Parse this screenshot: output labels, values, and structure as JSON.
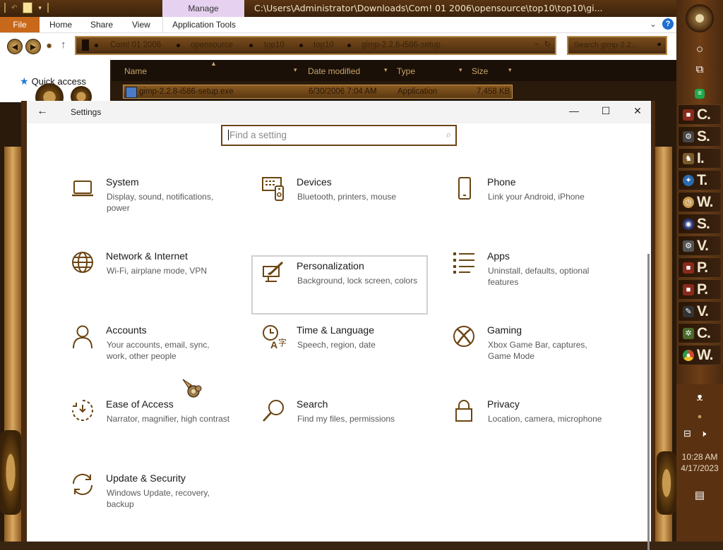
{
  "explorer": {
    "manage_tab": "Manage",
    "path": "C:\\Users\\Administrator\\Downloads\\Com! 01 2006\\opensource\\top10\\top10\\gi...",
    "ribbon": {
      "file": "File",
      "home": "Home",
      "share": "Share",
      "view": "View",
      "app_tools": "Application Tools"
    },
    "breadcrumbs": [
      "Com! 01 2006",
      "opensource",
      "top10",
      "top10",
      "gimp-2.2.8-i586-setup"
    ],
    "search_placeholder": "Search gimp-2.2...",
    "quick_access": "Quick access",
    "columns": {
      "name": "Name",
      "date": "Date modified",
      "type": "Type",
      "size": "Size"
    },
    "file": {
      "name": "gimp-2.2.8-i586-setup.exe",
      "date": "6/30/2006 7:04 AM",
      "type": "Application",
      "size": "7,458 KB"
    }
  },
  "taskbar": {
    "items": [
      {
        "letter": "C.",
        "icon": "explorer-icon",
        "color": "#8a2a1a"
      },
      {
        "letter": "S.",
        "icon": "gear-icon",
        "color": "#444444"
      },
      {
        "letter": "I.",
        "icon": "figure-icon",
        "color": "#7a5a2a"
      },
      {
        "letter": "T.",
        "icon": "globe-icon",
        "color": "#2a6ab0"
      },
      {
        "letter": "W.",
        "icon": "clock-icon",
        "color": "#c89a50"
      },
      {
        "letter": "S.",
        "icon": "steam-icon",
        "color": "#2a3a7a"
      },
      {
        "letter": "V.",
        "icon": "gear-icon",
        "color": "#555555"
      },
      {
        "letter": "P.",
        "icon": "box-icon",
        "color": "#8a2a1a"
      },
      {
        "letter": "P.",
        "icon": "box-icon",
        "color": "#8a2a1a"
      },
      {
        "letter": "V.",
        "icon": "vector-icon",
        "color": "#333333"
      },
      {
        "letter": "C.",
        "icon": "cog-icon",
        "color": "#4a6a2a"
      },
      {
        "letter": "W.",
        "icon": "chrome-icon",
        "color": "#d04a2a"
      }
    ],
    "time": "10:28 AM",
    "date": "4/17/2023"
  },
  "settings": {
    "window_title": "Settings",
    "search_placeholder": "Find a setting",
    "accent_color": "#6b4512",
    "categories": [
      {
        "name": "System",
        "desc": "Display, sound, notifications, power",
        "icon": "laptop-icon"
      },
      {
        "name": "Devices",
        "desc": "Bluetooth, printers, mouse",
        "icon": "devices-icon"
      },
      {
        "name": "Phone",
        "desc": "Link your Android, iPhone",
        "icon": "phone-icon"
      },
      {
        "name": "Network & Internet",
        "desc": "Wi-Fi, airplane mode, VPN",
        "icon": "globe-icon"
      },
      {
        "name": "Personalization",
        "desc": "Background, lock screen, colors",
        "icon": "paintbrush-icon"
      },
      {
        "name": "Apps",
        "desc": "Uninstall, defaults, optional features",
        "icon": "apps-list-icon"
      },
      {
        "name": "Accounts",
        "desc": "Your accounts, email, sync, work, other people",
        "icon": "person-icon"
      },
      {
        "name": "Time & Language",
        "desc": "Speech, region, date",
        "icon": "time-language-icon"
      },
      {
        "name": "Gaming",
        "desc": "Xbox Game Bar, captures, Game Mode",
        "icon": "xbox-icon"
      },
      {
        "name": "Ease of Access",
        "desc": "Narrator, magnifier, high contrast",
        "icon": "ease-of-access-icon"
      },
      {
        "name": "Search",
        "desc": "Find my files, permissions",
        "icon": "magnifier-icon"
      },
      {
        "name": "Privacy",
        "desc": "Location, camera, microphone",
        "icon": "lock-icon"
      },
      {
        "name": "Update & Security",
        "desc": "Windows Update, recovery, backup",
        "icon": "sync-icon"
      }
    ]
  }
}
